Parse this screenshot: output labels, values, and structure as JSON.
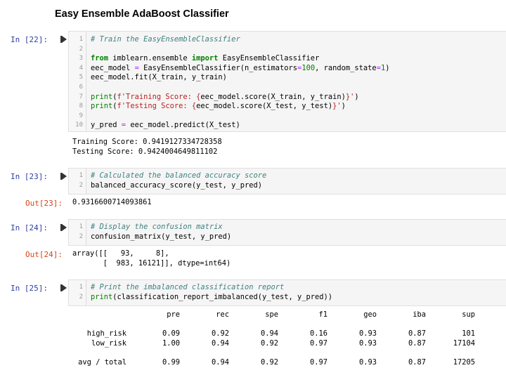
{
  "title": "Easy Ensemble AdaBoost Classifier",
  "cells": [
    {
      "prompt": "In [22]:",
      "lines": [
        {
          "n": "1",
          "code": "# Train the EasyEnsembleClassifier"
        },
        {
          "n": "2",
          "code": ""
        },
        {
          "n": "3",
          "code": "from imblearn.ensemble import EasyEnsembleClassifier"
        },
        {
          "n": "4",
          "code": "eec_model = EasyEnsembleClassifier(n_estimators=100, random_state=1)"
        },
        {
          "n": "5",
          "code": "eec_model.fit(X_train, y_train)"
        },
        {
          "n": "6",
          "code": ""
        },
        {
          "n": "7",
          "code": "print(f'Training Score: {eec_model.score(X_train, y_train)}')"
        },
        {
          "n": "8",
          "code": "print(f'Testing Score: {eec_model.score(X_test, y_test)}')"
        },
        {
          "n": "9",
          "code": ""
        },
        {
          "n": "10",
          "code": "y_pred = eec_model.predict(X_test)"
        }
      ],
      "output": [
        "Training Score: 0.9419127334728358",
        "Testing Score: 0.9424004649811102"
      ]
    },
    {
      "prompt": "In [23]:",
      "lines": [
        {
          "n": "1",
          "code": "# Calculated the balanced accuracy score"
        },
        {
          "n": "2",
          "code": "balanced_accuracy_score(y_test, y_pred)"
        }
      ],
      "out_prompt": "Out[23]:",
      "output": [
        "0.9316600714093861"
      ]
    },
    {
      "prompt": "In [24]:",
      "lines": [
        {
          "n": "1",
          "code": "# Display the confusion matrix"
        },
        {
          "n": "2",
          "code": "confusion_matrix(y_test, y_pred)"
        }
      ],
      "out_prompt": "Out[24]:",
      "output": [
        "array([[   93,     8],",
        "       [  983, 16121]], dtype=int64)"
      ]
    },
    {
      "prompt": "In [25]:",
      "lines": [
        {
          "n": "1",
          "code": "# Print the imbalanced classification report"
        },
        {
          "n": "2",
          "code": "print(classification_report_imbalanced(y_test, y_pred))"
        }
      ]
    }
  ],
  "report": {
    "headers": [
      "pre",
      "rec",
      "spe",
      "f1",
      "geo",
      "iba",
      "sup"
    ],
    "rows": [
      {
        "label": "high_risk",
        "values": [
          "0.09",
          "0.92",
          "0.94",
          "0.16",
          "0.93",
          "0.87",
          "101"
        ]
      },
      {
        "label": "low_risk",
        "values": [
          "1.00",
          "0.94",
          "0.92",
          "0.97",
          "0.93",
          "0.87",
          "17104"
        ]
      },
      {
        "label": "avg / total",
        "values": [
          "0.99",
          "0.94",
          "0.92",
          "0.97",
          "0.93",
          "0.87",
          "17205"
        ]
      }
    ]
  }
}
